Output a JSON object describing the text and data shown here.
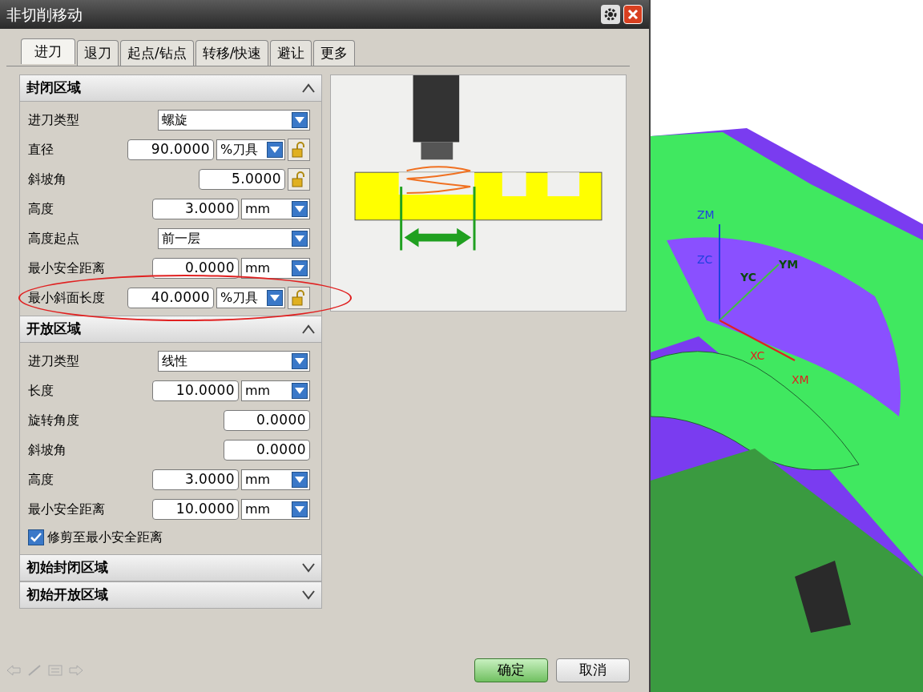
{
  "window": {
    "title": "非切削移动"
  },
  "tabs": [
    {
      "label": "进刀",
      "selected": true
    },
    {
      "label": "退刀",
      "selected": false
    },
    {
      "label": "起点/钻点",
      "selected": false
    },
    {
      "label": "转移/快速",
      "selected": false
    },
    {
      "label": "避让",
      "selected": false
    },
    {
      "label": "更多",
      "selected": false
    }
  ],
  "sections": [
    {
      "title": "封闭区域",
      "expanded": true,
      "rows": [
        {
          "kind": "select",
          "label": "进刀类型",
          "value": "螺旋"
        },
        {
          "kind": "value_unit_lock",
          "label": "直径",
          "value": "90.0000",
          "unit": "%刀具"
        },
        {
          "kind": "value_lock",
          "label": "斜坡角",
          "value": "5.0000"
        },
        {
          "kind": "value_unit",
          "label": "高度",
          "value": "3.0000",
          "unit": "mm"
        },
        {
          "kind": "select",
          "label": "高度起点",
          "value": "前一层"
        },
        {
          "kind": "value_unit",
          "label": "最小安全距离",
          "value": "0.0000",
          "unit": "mm"
        },
        {
          "kind": "value_unit_lock",
          "label": "最小斜面长度",
          "value": "40.0000",
          "unit": "%刀具",
          "highlighted": true
        }
      ]
    },
    {
      "title": "开放区域",
      "expanded": true,
      "rows": [
        {
          "kind": "select",
          "label": "进刀类型",
          "value": "线性"
        },
        {
          "kind": "value_unit",
          "label": "长度",
          "value": "10.0000",
          "unit": "mm"
        },
        {
          "kind": "value",
          "label": "旋转角度",
          "value": "0.0000"
        },
        {
          "kind": "value",
          "label": "斜坡角",
          "value": "0.0000"
        },
        {
          "kind": "value_unit",
          "label": "高度",
          "value": "3.0000",
          "unit": "mm"
        },
        {
          "kind": "value_unit",
          "label": "最小安全距离",
          "value": "10.0000",
          "unit": "mm"
        },
        {
          "kind": "checkbox",
          "label": "修剪至最小安全距离",
          "checked": true
        }
      ]
    },
    {
      "title": "初始封闭区域",
      "expanded": false
    },
    {
      "title": "初始开放区域",
      "expanded": false
    }
  ],
  "buttons": [
    {
      "label": "确定",
      "default": true
    },
    {
      "label": "取消",
      "default": false
    }
  ],
  "viewport": {
    "axis_labels": [
      "ZM",
      "ZC",
      "YM",
      "YC",
      "XC",
      "XM"
    ]
  }
}
